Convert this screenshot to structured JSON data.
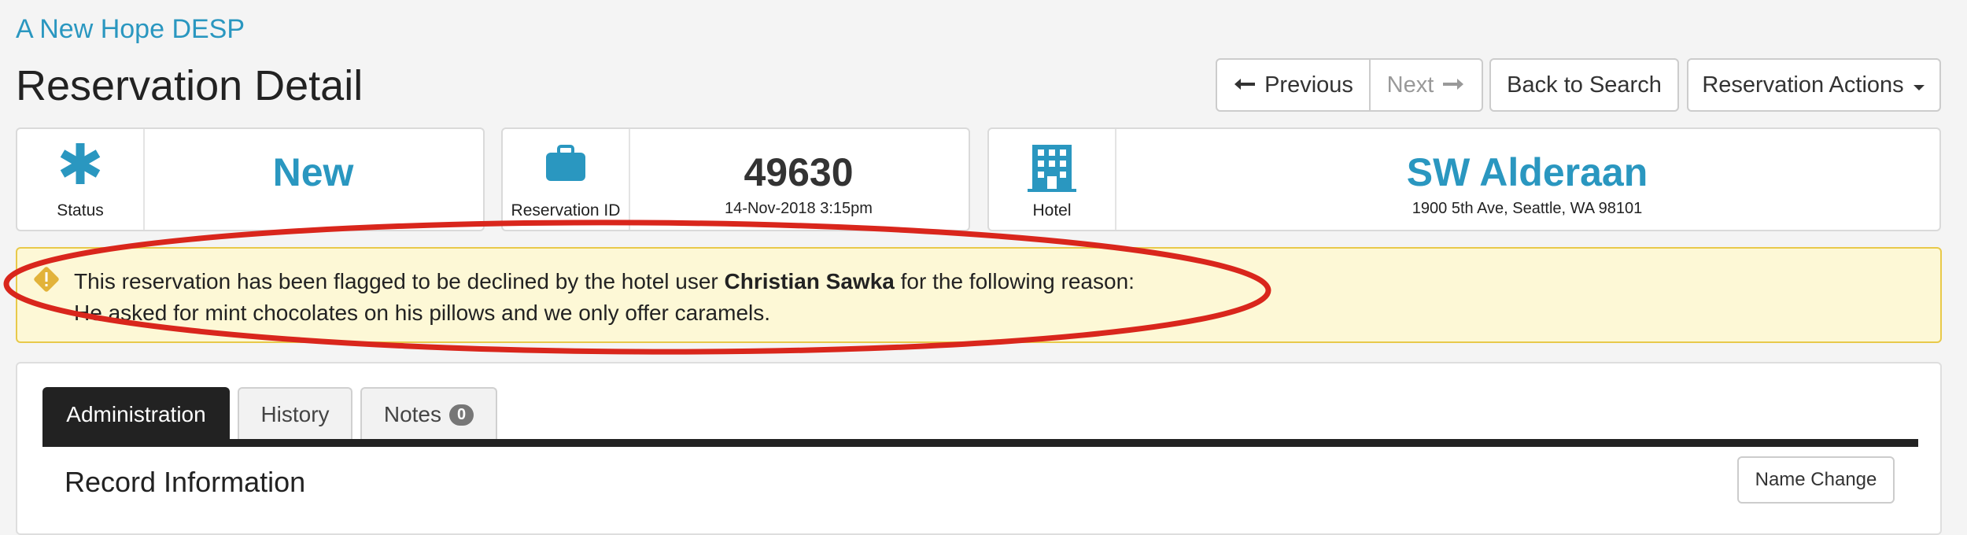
{
  "header": {
    "brand": "A New Hope DESP",
    "title": "Reservation Detail"
  },
  "toolbar": {
    "previous_label": "Previous",
    "next_label": "Next",
    "back_label": "Back to Search",
    "actions_label": "Reservation Actions"
  },
  "cards": {
    "status": {
      "label": "Status",
      "value": "New"
    },
    "reservation": {
      "label": "Reservation ID",
      "value": "49630",
      "date": "14-Nov-2018 3:15pm"
    },
    "hotel": {
      "label": "Hotel",
      "name": "SW Alderaan",
      "address": "1900 5th Ave, Seattle, WA 98101"
    }
  },
  "alert": {
    "line1_prefix": "This reservation has been flagged to be declined by the hotel user ",
    "user": "Christian Sawka",
    "line1_suffix": " for the following reason:",
    "reason": "He asked for mint chocolates on his pillows and we only offer caramels."
  },
  "tabs": {
    "administration": "Administration",
    "history": "History",
    "notes": "Notes",
    "notes_count": "0"
  },
  "section": {
    "title": "Record Information",
    "name_change": "Name Change"
  },
  "colors": {
    "accent": "#2a97c0",
    "alert_bg": "#fdf8d6",
    "alert_border": "#e8c94a",
    "annotation": "#d9261c"
  }
}
